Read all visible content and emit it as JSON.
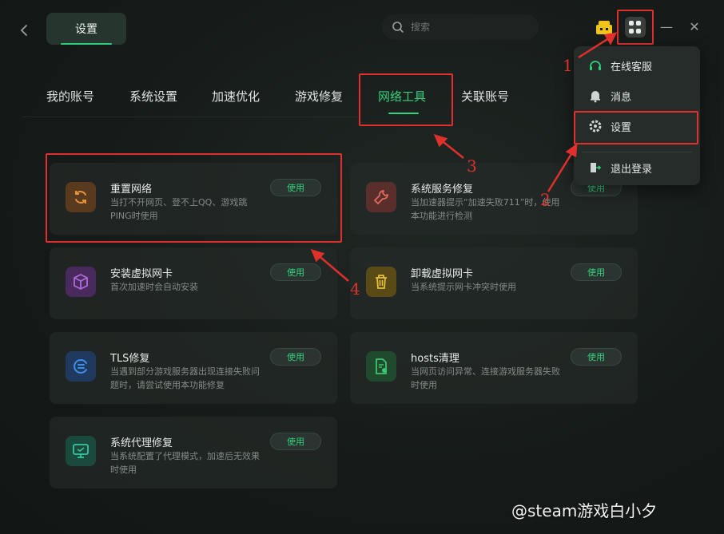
{
  "header": {
    "title": "设置",
    "search_placeholder": "搜索"
  },
  "tabs": [
    {
      "label": "我的账号"
    },
    {
      "label": "系统设置"
    },
    {
      "label": "加速优化"
    },
    {
      "label": "游戏修复"
    },
    {
      "label": "网络工具"
    },
    {
      "label": "关联账号"
    }
  ],
  "active_tab": "网络工具",
  "cards": [
    {
      "title": "重置网络",
      "desc": "当打不开网页、登不上QQ、游戏跳PING时使用",
      "button": "使用",
      "icon": "refresh-icon",
      "color": "#e3933a"
    },
    {
      "title": "系统服务修复",
      "desc": "当加速器提示“加速失败711”时，使用本功能进行检测",
      "button": "使用",
      "icon": "wrench-icon",
      "color": "#e06b5e"
    },
    {
      "title": "安装虚拟网卡",
      "desc": "首次加速时会自动安装",
      "button": "使用",
      "icon": "box-icon",
      "color": "#b06ad6"
    },
    {
      "title": "卸载虚拟网卡",
      "desc": "当系统提示网卡冲突时使用",
      "button": "使用",
      "icon": "trash-icon",
      "color": "#e5bf3a"
    },
    {
      "title": "TLS修复",
      "desc": "当遇到部分游戏服务器出现连接失败问题时，请尝试使用本功能修复",
      "button": "使用",
      "icon": "tls-icon",
      "color": "#3d8ee8"
    },
    {
      "title": "hosts清理",
      "desc": "当网页访问异常、连接游戏服务器失败时使用",
      "button": "使用",
      "icon": "file-clean-icon",
      "color": "#3cc46e"
    },
    {
      "title": "系统代理修复",
      "desc": "当系统配置了代理模式，加速后无效果时使用",
      "button": "使用",
      "icon": "monitor-icon",
      "color": "#36c6a0"
    }
  ],
  "dropdown": {
    "items": [
      {
        "label": "在线客服",
        "icon": "headset-icon"
      },
      {
        "label": "消息",
        "icon": "bell-icon"
      },
      {
        "label": "设置",
        "icon": "gear-icon"
      },
      {
        "label": "退出登录",
        "icon": "logout-icon"
      }
    ]
  },
  "annotations": [
    "1",
    "2",
    "3",
    "4"
  ],
  "watermark": "@steam游戏白小夕",
  "colors": {
    "accent": "#36d17f",
    "annotation": "#e0302c"
  }
}
